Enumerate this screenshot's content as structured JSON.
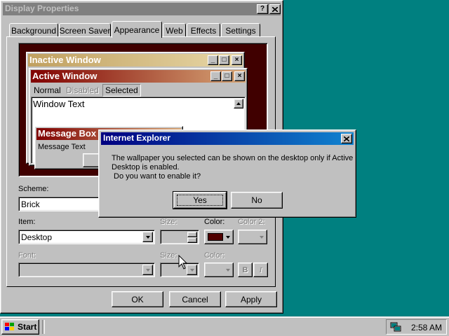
{
  "colors": {
    "desktop": "#008080",
    "active_title_start": "#800000",
    "active_title_end": "#d8a878",
    "inactive_title_start": "#c0a060",
    "inactive_title_end": "#e8d8a8",
    "scheme_background": "#400000",
    "ie_title_start": "#000080",
    "selected_color_swatch": "#500000"
  },
  "main_window": {
    "title": "Display Properties",
    "help_label": "?",
    "close_label": "✕",
    "tabs": [
      "Background",
      "Screen Saver",
      "Appearance",
      "Web",
      "Effects",
      "Settings"
    ],
    "active_tab": "Appearance",
    "preview": {
      "inactive_title": "Inactive Window",
      "active_title": "Active Window",
      "menu_normal": "Normal",
      "menu_disabled": "Disabled",
      "menu_selected": "Selected",
      "window_text": "Window Text",
      "msgbox_title": "Message Box",
      "msgbox_text": "Message Text"
    },
    "scheme_label": "Scheme:",
    "scheme_value": "Brick",
    "item_label": "Item:",
    "item_value": "Desktop",
    "size_label": "Size:",
    "color_label": "Color:",
    "color2_label": "Color 2:",
    "font_label": "Font:",
    "font_size_label": "Size:",
    "font_color_label": "Color:",
    "bold_label": "B",
    "italic_label": "I",
    "ok_label": "OK",
    "cancel_label": "Cancel",
    "apply_label": "Apply"
  },
  "dialog": {
    "title": "Internet Explorer",
    "message_line1": "The wallpaper you selected can be shown on the desktop only if Active",
    "message_line2": "Desktop is enabled.",
    "message_line3": "Do you want to enable it?",
    "yes_label": "Yes",
    "no_label": "No"
  },
  "taskbar": {
    "start_label": "Start",
    "clock": "2:58 AM"
  }
}
